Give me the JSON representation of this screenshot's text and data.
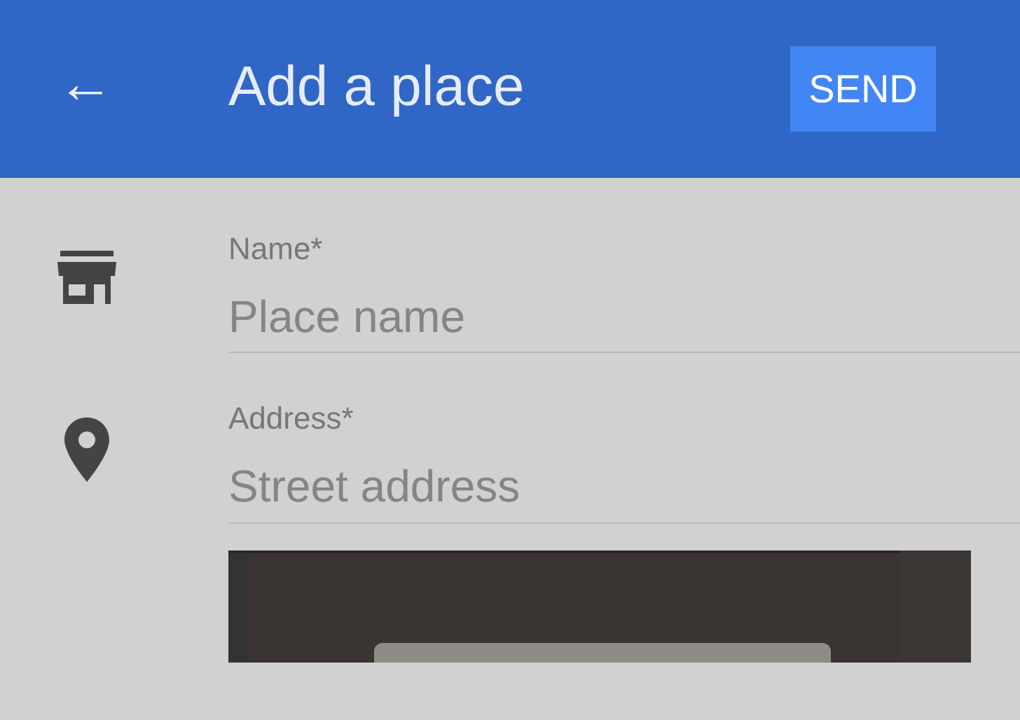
{
  "app_bar": {
    "back": "←",
    "title": "Add a place",
    "action": "SEND"
  },
  "fields": [
    {
      "kind": "name",
      "label": "Name*",
      "placeholder": "Place name"
    },
    {
      "kind": "address",
      "label": "Address*",
      "placeholder": "Street address"
    }
  ]
}
